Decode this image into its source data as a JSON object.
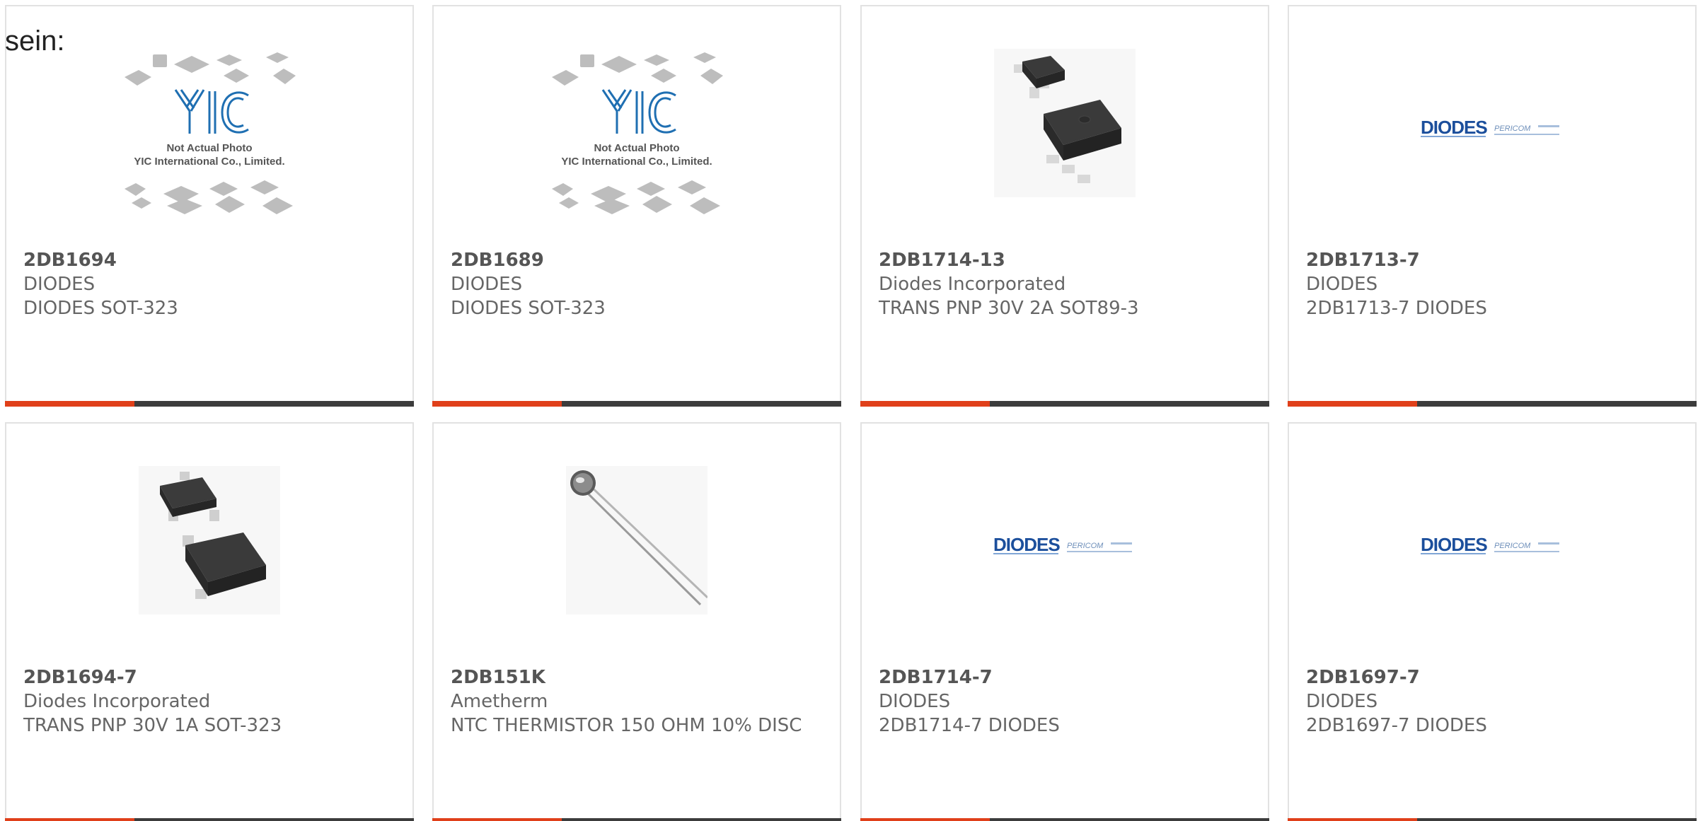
{
  "lead_text": "sein:",
  "products": [
    {
      "part_number": "2DB1694",
      "manufacturer": "DIODES",
      "description": "DIODES SOT-323",
      "image": "yic-placeholder-image",
      "placeholder_line1": "Not Actual Photo",
      "placeholder_line2": "YIC International Co., Limited."
    },
    {
      "part_number": "2DB1689",
      "manufacturer": "DIODES",
      "description": "DIODES SOT-323",
      "image": "yic-placeholder-image",
      "placeholder_line1": "Not Actual Photo",
      "placeholder_line2": "YIC International Co., Limited."
    },
    {
      "part_number": "2DB1714-13",
      "manufacturer": "Diodes Incorporated",
      "description": "TRANS PNP 30V 2A SOT89-3",
      "image": "sot89-package-image"
    },
    {
      "part_number": "2DB1713-7",
      "manufacturer": "DIODES",
      "description": "2DB1713-7 DIODES",
      "image": "diodes-pericom-logo",
      "logo_main": "DIODES",
      "logo_secondary": "PERICOM"
    },
    {
      "part_number": "2DB1694-7",
      "manufacturer": "Diodes Incorporated",
      "description": "TRANS PNP 30V 1A SOT-323",
      "image": "sot323-package-image"
    },
    {
      "part_number": "2DB151K",
      "manufacturer": "Ametherm",
      "description": "NTC THERMISTOR 150 OHM 10% DISC",
      "image": "thermistor-disc-image"
    },
    {
      "part_number": "2DB1714-7",
      "manufacturer": "DIODES",
      "description": "2DB1714-7 DIODES",
      "image": "diodes-pericom-logo",
      "logo_main": "DIODES",
      "logo_secondary": "PERICOM"
    },
    {
      "part_number": "2DB1697-7",
      "manufacturer": "DIODES",
      "description": "2DB1697-7 DIODES",
      "image": "diodes-pericom-logo",
      "logo_main": "DIODES",
      "logo_secondary": "PERICOM"
    }
  ],
  "colors": {
    "accent": "#e0401a",
    "bar": "#3c3c3c",
    "border": "#e2e2e2",
    "logo_blue": "#1c4f9c"
  }
}
